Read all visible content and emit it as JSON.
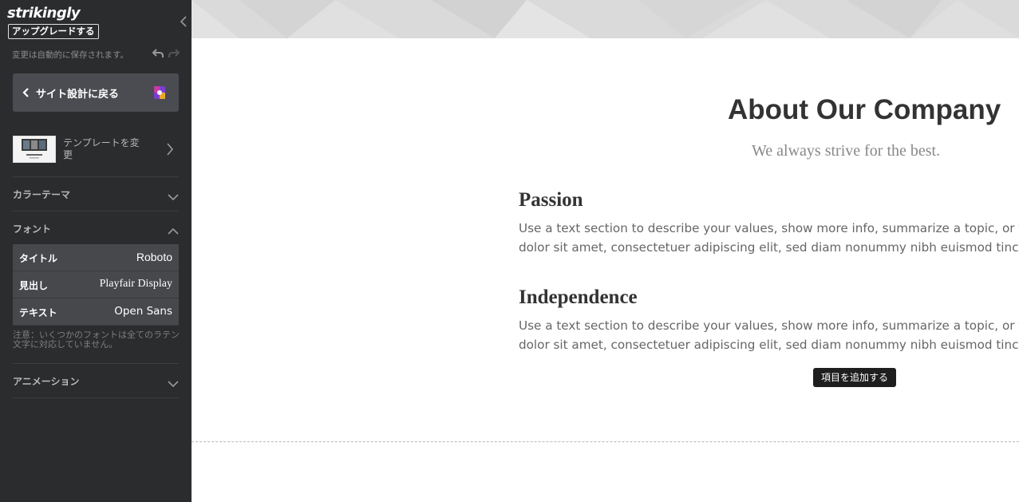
{
  "sidebar": {
    "logo": "strikingly",
    "upgrade_label": "アップグレードする",
    "autosave_text": "変更は自動的に保存されます。",
    "back_label": "サイト設計に戻る",
    "template_label": "テンプレートを変更",
    "sections": {
      "color_theme": "カラーテーマ",
      "fonts": "フォント",
      "animation": "アニメーション"
    },
    "font_rows": [
      {
        "label": "タイトル",
        "value": "Roboto"
      },
      {
        "label": "見出し",
        "value": "Playfair Display"
      },
      {
        "label": "テキスト",
        "value": "Open Sans"
      }
    ],
    "font_note": "注意：いくつかのフォントは全てのラテン文字に対応していません。"
  },
  "main": {
    "title": "About Our Company",
    "subtitle": "We always strive for the best.",
    "items": [
      {
        "heading": "Passion",
        "line1": "Use a text section to describe your values, show more info, summarize a topic, or t",
        "line2": "dolor sit amet, consectetuer adipiscing elit, sed diam nonummy nibh euismod tincic"
      },
      {
        "heading": "Independence",
        "line1": "Use a text section to describe your values, show more info, summarize a topic, or t",
        "line2": "dolor sit amet, consectetuer adipiscing elit, sed diam nonummy nibh euismod tincic"
      }
    ],
    "add_item_label": "項目を追加する"
  },
  "colors": {
    "sidebar_bg": "#2b2c2e",
    "back_button_bg": "#4a4c52",
    "font_row_bg": "#47484c",
    "banner_bg": "#dcdcdc",
    "add_item_bg": "#1e1e1e"
  },
  "icons": [
    "collapse-sidebar-icon",
    "undo-icon",
    "redo-icon",
    "chevron-left-icon",
    "app-color-icon",
    "chevron-right-icon",
    "chevron-down-icon",
    "chevron-up-icon"
  ]
}
